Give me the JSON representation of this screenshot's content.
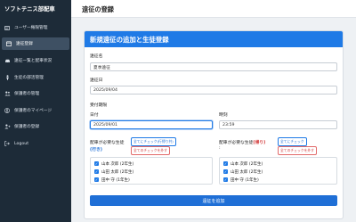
{
  "sidebar": {
    "brand": "ソフトテニス部配車",
    "items": [
      {
        "label": "ユーザー権限管理",
        "icon": "id-card-icon"
      },
      {
        "label": "遠征登録",
        "icon": "calendar-icon"
      },
      {
        "label": "遠征一覧と配車状況",
        "icon": "car-icon"
      },
      {
        "label": "生徒の部活管理",
        "icon": "person-icon"
      },
      {
        "label": "保護者の管理",
        "icon": "users-icon"
      },
      {
        "label": "保護者のマイページ",
        "icon": "user-circle-icon"
      },
      {
        "label": "保護者の登録",
        "icon": "user-plus-icon"
      },
      {
        "label": "Logout",
        "icon": "logout-icon"
      }
    ],
    "active_index": 1
  },
  "header": {
    "title": "遠征の登録"
  },
  "form": {
    "card_title": "新規遠征の追加と生徒登録",
    "name_label": "遠征名",
    "name_value": "夏季遠征",
    "date_label": "遠征日",
    "date_value": "2025/09/04",
    "deadline_heading": "受付期限",
    "deadline_date_label": "日付",
    "deadline_date_value": "2025/09/01",
    "deadline_time_label": "時刻",
    "deadline_time_value": "23:59",
    "go": {
      "label_prefix": "配車が必要な生徒",
      "label_tag": "(行き)",
      "check_all": "全てにチェック(行帰り共)",
      "clear_all": "全てのチェックを外す",
      "students": [
        "山本 次郎 (2年生)",
        "山田 太郎 (2年生)",
        "田中 守 (1年生)"
      ]
    },
    "return": {
      "label_prefix": "配車が必要な生徒",
      "label_tag": "(帰り)",
      "label_suffix": ":",
      "check_all": "全てにチェック",
      "clear_all": "全てのチェックを外す",
      "students": [
        "山本 次郎 (2年生)",
        "山田 太郎 (2年生)",
        "田中 守 (1年生)"
      ]
    },
    "submit_label": "遠征を追加"
  },
  "colors": {
    "sidebar_bg": "#1d2b38",
    "accent": "#1f7ae6",
    "danger": "#d23b3b"
  }
}
